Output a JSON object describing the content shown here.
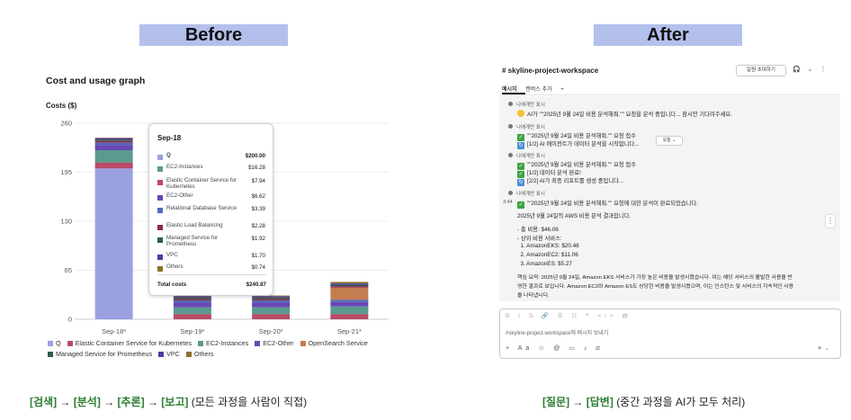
{
  "before": {
    "banner": "Before",
    "title": "Cost and usage graph",
    "y_axis_title": "Costs ($)",
    "caption_steps": [
      "[검색]",
      "→",
      "[분석]",
      "→",
      "[추론]",
      "→",
      "[보고]"
    ],
    "caption_note": "(모든 과정을 사람이 직접)"
  },
  "after": {
    "banner": "After",
    "caption_steps": [
      "[질문]",
      "→",
      "[답변]"
    ],
    "caption_note": "(중간 과정을 AI가 모두 처리)"
  },
  "tooltip": {
    "title": "Sep-18",
    "rows": [
      {
        "label": "Q",
        "value": "$200.00",
        "color": "#9aa1e0",
        "bold": true
      },
      {
        "label": "EC2-Instances",
        "value": "$16.28",
        "color": "#5a9a8f"
      },
      {
        "label": "Elastic Container Service for Kubernetes",
        "value": "$7.94",
        "color": "#b84b67"
      },
      {
        "label": "EC2-Other",
        "value": "$6.62",
        "color": "#6a46b5"
      },
      {
        "label": "Relational Database Service",
        "value": "$3.39",
        "color": "#5569b8"
      },
      {
        "label": "Elastic Load Balancing",
        "value": "$2.28",
        "color": "#8e2d4b"
      },
      {
        "label": "Managed Service for Prometheus",
        "value": "$1.92",
        "color": "#2f5c4f"
      },
      {
        "label": "VPC",
        "value": "$1.70",
        "color": "#4f3aa0"
      },
      {
        "label": "Others",
        "value": "$0.74",
        "color": "#8b7030"
      }
    ],
    "total_label": "Total costs",
    "total_value": "$240.87"
  },
  "legend": [
    {
      "name": "Q",
      "color": "#9aa1e0"
    },
    {
      "name": "Elastic Container Service for Kubernetes",
      "color": "#b84b67"
    },
    {
      "name": "EC2-Instances",
      "color": "#5a9a8f"
    },
    {
      "name": "EC2-Other",
      "color": "#6a46b5"
    },
    {
      "name": "OpenSearch Service",
      "color": "#c47d50"
    },
    {
      "name": "Managed Service for Prometheus",
      "color": "#2f5c4f"
    },
    {
      "name": "VPC",
      "color": "#4f3aa0"
    },
    {
      "name": "Others",
      "color": "#8b7030"
    }
  ],
  "chart_data": {
    "type": "bar",
    "stacked": true,
    "categories": [
      "Sep-18*",
      "Sep-19*",
      "Sep-20*",
      "Sep-21*"
    ],
    "y_ticks": [
      "0",
      "65",
      "130",
      "195",
      "260"
    ],
    "ylim": [
      0,
      260
    ],
    "grid": true,
    "series": [
      {
        "name": "Q",
        "color": "#9aa1e0",
        "values": [
          200,
          0,
          0,
          0
        ]
      },
      {
        "name": "Elastic Container Service for Kubernetes",
        "color": "#b84b67",
        "values": [
          7.94,
          7,
          7,
          7
        ]
      },
      {
        "name": "EC2-Instances",
        "color": "#5a9a8f",
        "values": [
          16.28,
          9,
          9,
          10
        ]
      },
      {
        "name": "EC2-Other",
        "color": "#6a46b5",
        "values": [
          6.62,
          6,
          6,
          6
        ]
      },
      {
        "name": "Relational Database Service",
        "color": "#5569b8",
        "values": [
          3.39,
          3,
          3,
          3
        ]
      },
      {
        "name": "OpenSearch Service",
        "color": "#c47d50",
        "values": [
          0,
          0,
          0,
          16
        ]
      },
      {
        "name": "Elastic Load Balancing",
        "color": "#8e2d4b",
        "values": [
          2.28,
          2,
          2,
          2
        ]
      },
      {
        "name": "Managed Service for Prometheus",
        "color": "#2f5c4f",
        "values": [
          1.92,
          2,
          2,
          2
        ]
      },
      {
        "name": "VPC",
        "color": "#4f3aa0",
        "values": [
          1.7,
          1.5,
          1.5,
          1.5
        ]
      },
      {
        "name": "Others",
        "color": "#8b7030",
        "values": [
          0.74,
          1,
          1,
          2
        ]
      }
    ]
  },
  "slack": {
    "channel": "# skyline-project-workspace",
    "invite_button": "일원 초대하기",
    "header_icons": "🎧 ⌄ ⋮",
    "tabs": [
      "메시지",
      "캔버스 추가",
      "+"
    ],
    "pill": "오늘 ⌄",
    "messages": [
      {
        "kind": "meta",
        "text": "나에게만 표시"
      },
      {
        "kind": "face",
        "text": "AI가 \"\"2025년 9월 24일 비용 분석해줘.\"\" 요청을 분석 중입니다... 잠시만 기다려주세요."
      },
      {
        "kind": "meta",
        "text": "나에게만 표시"
      },
      {
        "kind": "chk",
        "text": "\"\"2025년 9월 24일 비용 분석해줘.\"\" 요청 접수"
      },
      {
        "kind": "sync",
        "text": "[1/2] AI 에이전트가 데이터 분석을 시작합니다..."
      },
      {
        "kind": "meta",
        "text": "나에게만 표시"
      },
      {
        "kind": "chk",
        "text": "\"\"2025년 9월 24일 비용 분석해줘.\"\" 요청 접수"
      },
      {
        "kind": "chk",
        "text": "[1/2] 데이터 분석 완료!"
      },
      {
        "kind": "sync",
        "text": "[2/2] AI가 최종 리포트를 생성 중입니다..."
      },
      {
        "kind": "meta",
        "text": "나에게만 표시"
      },
      {
        "kind": "chk",
        "text": "\"\"2025년 9월 24일 비용 분석해줘.\"\" 요청에 대한 분석이 완료되었습니다."
      }
    ],
    "timestamp": "3:44",
    "report_title": "2025년 9월 24일의 AWS 비용 분석 결과입니다.",
    "report_lines": [
      "- 총 비용: $46.06",
      "- 상위 비용 서비스:",
      "  1. AmazonEKS: $20.48",
      "  2. AmazonEC2: $11.06",
      "  3. AmazonES: $5.27"
    ],
    "summary_lines": [
      "핵심 요약: 2025년 9월 24일, Amazon EKS 서비스가 가장 높은 비용을 발생시켰습니다. 이는 해당 서비스의 활발한 사용을 반",
      "영한 결과로 보입니다. Amazon EC2와 Amazon ES도 상당한 비용을 발생시켰으며, 이는 인스턴스 및 서비스의 지속적인 사용",
      "을 나타냅니다."
    ],
    "composer_tools": "B I S̶ 🔗 ☰ ☷ ❝ </> ▤",
    "composer_placeholder": "#skyline-project-workspace에 메시지 보내기",
    "composer_bottom": "+ Aa ☺ @ ▭ ♪ ⧄",
    "send_icon": "➤ ⌄"
  }
}
